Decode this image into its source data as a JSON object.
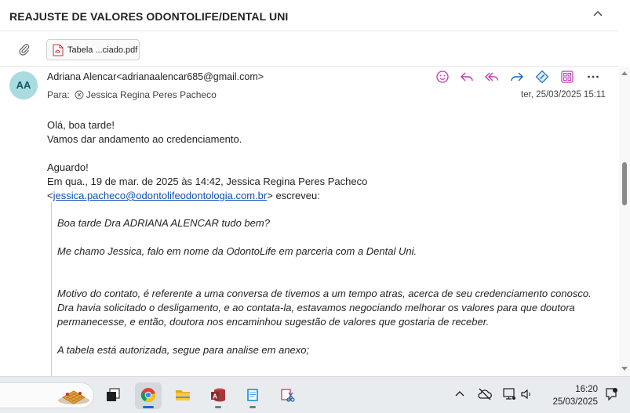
{
  "email": {
    "subject": "REAJUSTE DE VALORES ODONTOLIFE/DENTAL UNI",
    "attachment": {
      "name": "Tabela ...ciado.pdf"
    },
    "avatar_initials": "AA",
    "sender": "Adriana Alencar<adrianaalencar685@gmail.com>",
    "to_label": "Para:",
    "to_name": "Jessica Regina Peres Pacheco",
    "date": "ter, 25/03/2025 15:11",
    "body": {
      "line1": "Olá, boa tarde!",
      "line2": "Vamos dar andamento ao credenciamento.",
      "line3": "Aguardo!",
      "line4": "Em qua., 19 de mar. de 2025 às 14:42, Jessica Regina Peres Pacheco",
      "open_bracket": "<",
      "link": "jessica.pacheco@odontolifeodontologia.com.br",
      "after_link": "> escreveu:"
    },
    "quote": {
      "q1": "Boa tarde Dra ADRIANA ALENCAR tudo bem?",
      "q2": "Me chamo Jessica, falo em nome da OdontoLife em parceria com a Dental Uni.",
      "q3": "Motivo do contato, é referente a uma conversa de tivemos a um tempo atras, acerca de seu credenciamento conosco.",
      "q4": "Dra havia solicitado o desligamento, e ao contata-la, estavamos negociando melhorar os valores para que doutora permanecesse, e então, doutora nos encaminhou sugestão de valores que gostaria de receber.",
      "q5": "A tabela está autorizada, segue para analise em anexo;"
    }
  },
  "taskbar": {
    "clock_time": "16:20",
    "clock_date": "25/03/2025"
  },
  "colors": {
    "accent_purple": "#c239b3",
    "accent_blue": "#0f6cbd",
    "link": "#0f4fb3",
    "avatar_bg": "#aadbe0"
  }
}
